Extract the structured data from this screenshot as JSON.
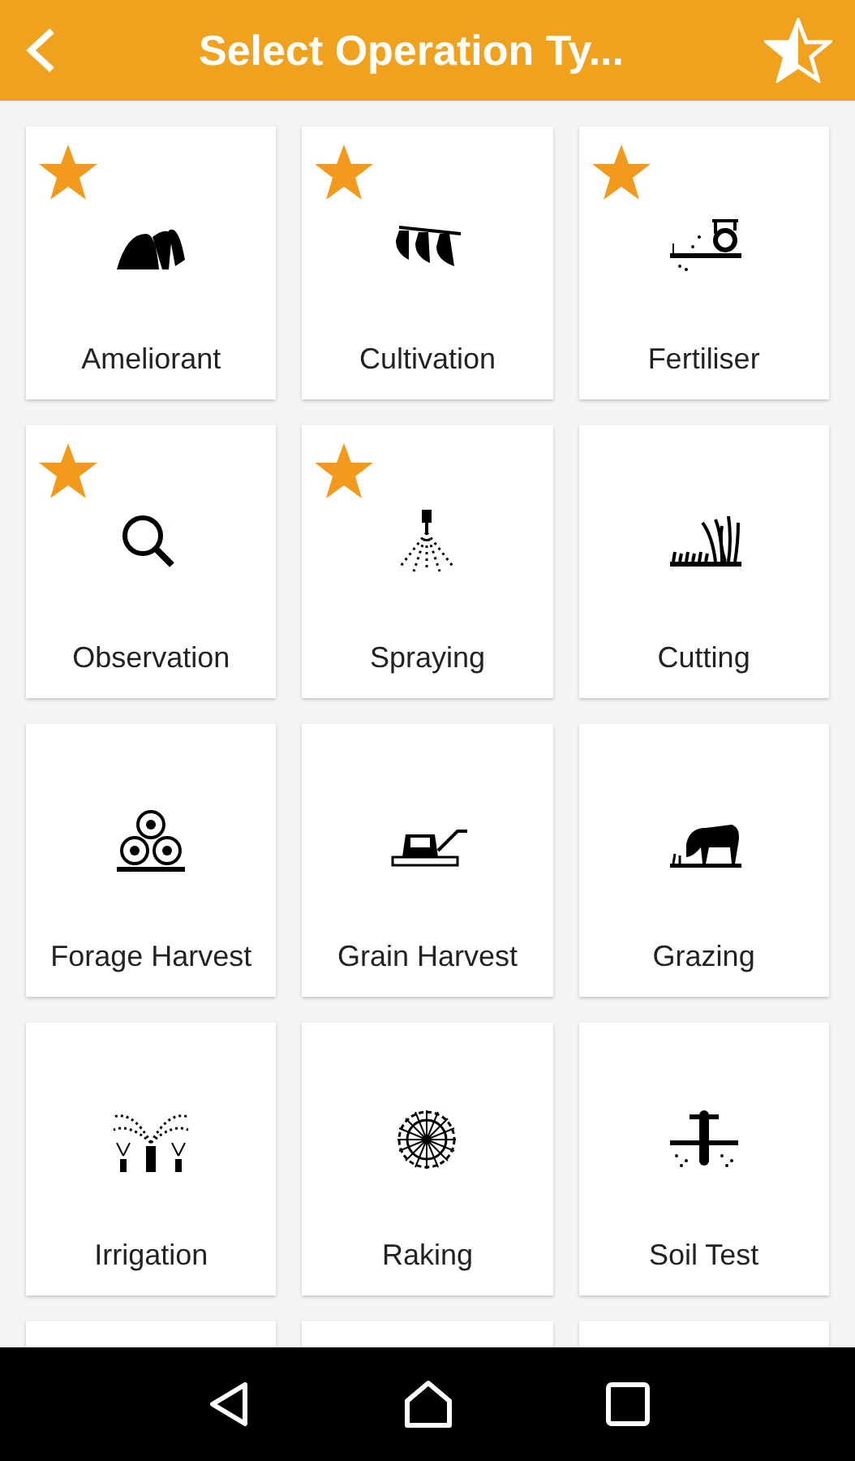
{
  "header": {
    "title": "Select Operation Ty..."
  },
  "tiles": [
    {
      "kind": "tile",
      "label": "Ameliorant",
      "favorite": true
    },
    {
      "kind": "tile",
      "label": "Cultivation",
      "favorite": true
    },
    {
      "kind": "tile",
      "label": "Fertiliser",
      "favorite": true
    },
    {
      "kind": "tile",
      "label": "Observation",
      "favorite": true
    },
    {
      "kind": "tile",
      "label": "Spraying",
      "favorite": true
    },
    {
      "kind": "tile",
      "label": "Cutting",
      "favorite": false
    },
    {
      "kind": "tile",
      "label": "Forage Harvest",
      "favorite": false
    },
    {
      "kind": "tile",
      "label": "Grain Harvest",
      "favorite": false
    },
    {
      "kind": "tile",
      "label": "Grazing",
      "favorite": false
    },
    {
      "kind": "tile",
      "label": "Irrigation",
      "favorite": false
    },
    {
      "kind": "tile",
      "label": "Raking",
      "favorite": false
    },
    {
      "kind": "tile",
      "label": "Soil Test",
      "favorite": false
    },
    {
      "kind": "partial"
    },
    {
      "kind": "partial"
    },
    {
      "kind": "partial"
    }
  ]
}
